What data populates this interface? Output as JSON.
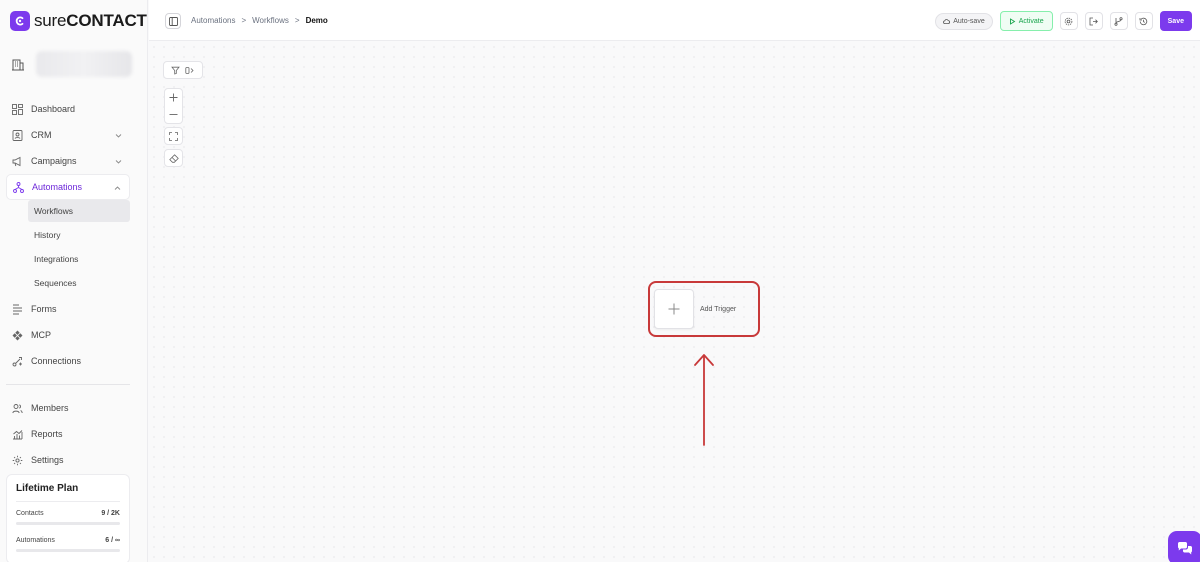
{
  "brand": {
    "name_light": "sure",
    "name_bold": "CONTACT",
    "accent": "#7c3aed"
  },
  "sidebar": {
    "items": [
      {
        "label": "Dashboard",
        "icon": "grid-icon"
      },
      {
        "label": "CRM",
        "icon": "contact-card-icon"
      },
      {
        "label": "Campaigns",
        "icon": "megaphone-icon"
      },
      {
        "label": "Automations",
        "icon": "workflow-icon"
      },
      {
        "label": "Forms",
        "icon": "form-icon"
      },
      {
        "label": "MCP",
        "icon": "mcp-icon"
      },
      {
        "label": "Connections",
        "icon": "connections-icon"
      },
      {
        "label": "Members",
        "icon": "users-icon"
      },
      {
        "label": "Reports",
        "icon": "chart-icon"
      },
      {
        "label": "Settings",
        "icon": "gear-icon"
      }
    ],
    "automations_sub": [
      "Workflows",
      "History",
      "Integrations",
      "Sequences"
    ]
  },
  "plan": {
    "title": "Lifetime Plan",
    "contacts_label": "Contacts",
    "contacts_value": "9 / 2K",
    "automations_label": "Automations",
    "automations_value": "6 / ∞"
  },
  "header": {
    "breadcrumb": [
      "Automations",
      "Workflows",
      "Demo"
    ],
    "separator": ">",
    "autosave": "Auto-save",
    "activate": "Activate",
    "save": "Save"
  },
  "canvas": {
    "trigger_label": "Add Trigger"
  }
}
